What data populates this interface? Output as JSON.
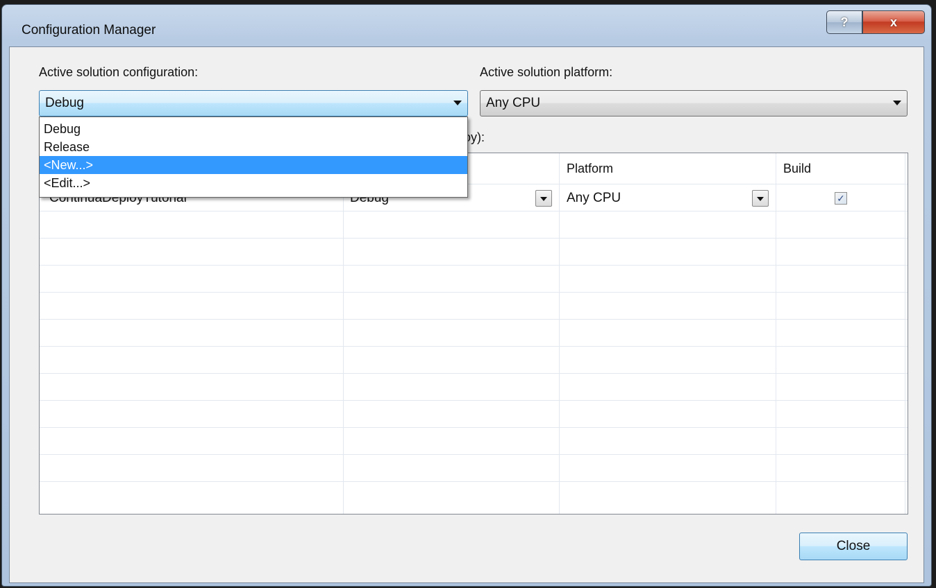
{
  "window": {
    "title": "Configuration Manager",
    "help_glyph": "?",
    "close_glyph": "x"
  },
  "config": {
    "label": "Active solution configuration:",
    "value": "Debug",
    "options": [
      "Debug",
      "Release",
      "<New...>",
      "<Edit...>"
    ],
    "highlighted_option": "<New...>"
  },
  "platform": {
    "label": "Active solution platform:",
    "value": "Any CPU"
  },
  "contexts": {
    "label_partial": "ploy):",
    "columns": [
      "Platform",
      "Build"
    ],
    "rows": [
      {
        "project": "ContinuaDeployTutorial",
        "configuration": "Debug",
        "platform": "Any CPU",
        "build": true
      }
    ]
  },
  "buttons": {
    "close": "Close"
  },
  "colors": {
    "selection": "#3399ff",
    "accent_border": "#3c7fb1"
  }
}
